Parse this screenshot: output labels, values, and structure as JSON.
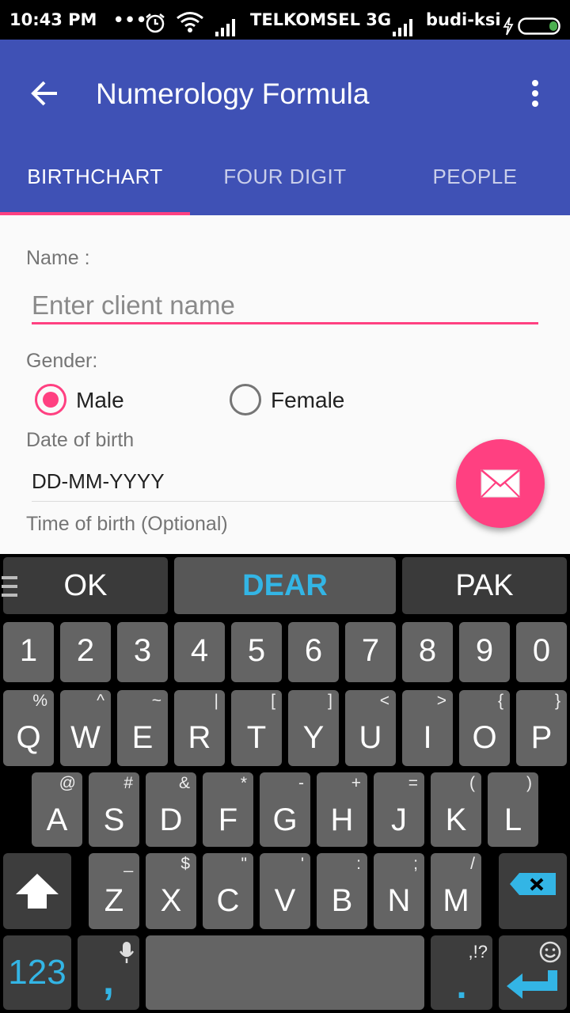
{
  "status_bar": {
    "time": "10:43 PM",
    "dots": "•••",
    "carrier": "TELKOMSEL 3G",
    "user": "budi-ksi"
  },
  "app_bar": {
    "title": "Numerology Formula",
    "tabs": [
      {
        "label": "BIRTHCHART",
        "selected": true
      },
      {
        "label": "FOUR DIGIT",
        "selected": false
      },
      {
        "label": "PEOPLE",
        "selected": false
      }
    ]
  },
  "form": {
    "name_label": "Name :",
    "name_placeholder": "Enter client name",
    "name_value": "",
    "gender_label": "Gender:",
    "gender_options": [
      {
        "label": "Male",
        "selected": true
      },
      {
        "label": "Female",
        "selected": false
      }
    ],
    "dob_label": "Date of birth",
    "dob_value": "DD-MM-YYYY",
    "tob_label": "Time of birth (Optional)"
  },
  "keyboard": {
    "suggestions": [
      "OK",
      "DEAR",
      "PAK"
    ],
    "row_numbers": [
      "1",
      "2",
      "3",
      "4",
      "5",
      "6",
      "7",
      "8",
      "9",
      "0"
    ],
    "row_q": [
      {
        "key": "Q",
        "hint": "%"
      },
      {
        "key": "W",
        "hint": "^"
      },
      {
        "key": "E",
        "hint": "~"
      },
      {
        "key": "R",
        "hint": "|"
      },
      {
        "key": "T",
        "hint": "["
      },
      {
        "key": "Y",
        "hint": "]"
      },
      {
        "key": "U",
        "hint": "<"
      },
      {
        "key": "I",
        "hint": ">"
      },
      {
        "key": "O",
        "hint": "{"
      },
      {
        "key": "P",
        "hint": "}"
      }
    ],
    "row_a": [
      {
        "key": "A",
        "hint": "@"
      },
      {
        "key": "S",
        "hint": "#"
      },
      {
        "key": "D",
        "hint": "&"
      },
      {
        "key": "F",
        "hint": "*"
      },
      {
        "key": "G",
        "hint": "-"
      },
      {
        "key": "H",
        "hint": "+"
      },
      {
        "key": "J",
        "hint": "="
      },
      {
        "key": "K",
        "hint": "("
      },
      {
        "key": "L",
        "hint": ")"
      }
    ],
    "row_z": [
      {
        "key": "Z",
        "hint": "_"
      },
      {
        "key": "X",
        "hint": "$"
      },
      {
        "key": "C",
        "hint": "\""
      },
      {
        "key": "V",
        "hint": "'"
      },
      {
        "key": "B",
        "hint": ":"
      },
      {
        "key": "N",
        "hint": ";"
      },
      {
        "key": "M",
        "hint": "/"
      }
    ],
    "symbols_key": "123",
    "comma_key": ",",
    "period_key": ".",
    "period_hint": ",!?"
  },
  "colors": {
    "primary": "#3f51b5",
    "accent": "#ff4081",
    "keyboard_accent": "#33b5e5"
  }
}
